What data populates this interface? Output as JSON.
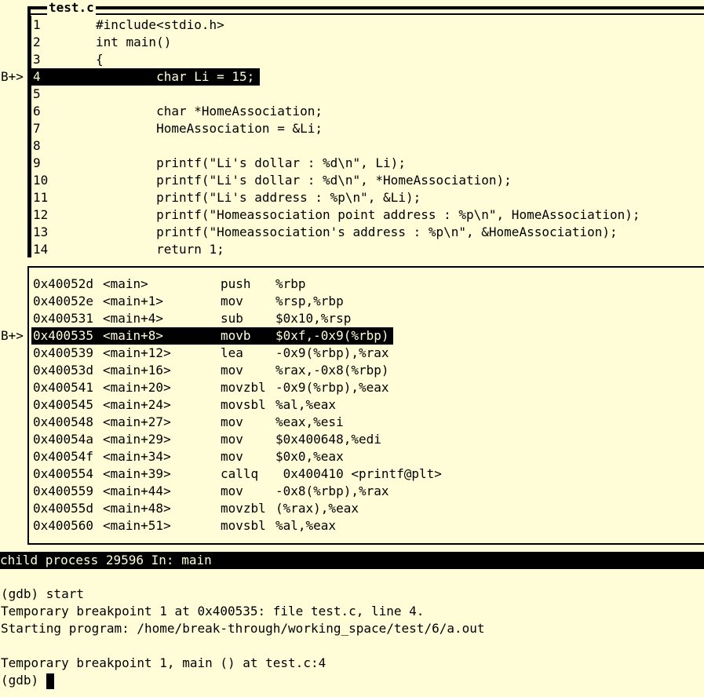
{
  "source": {
    "title": "test.c",
    "breakpoint_marker": "B+>",
    "lines": [
      {
        "num": "1",
        "code": "#include<stdio.h>"
      },
      {
        "num": "2",
        "code": "int main()"
      },
      {
        "num": "3",
        "code": "{"
      },
      {
        "num": "4",
        "code": "        char Li = 15;"
      },
      {
        "num": "5",
        "code": ""
      },
      {
        "num": "6",
        "code": "        char *HomeAssociation;"
      },
      {
        "num": "7",
        "code": "        HomeAssociation = &Li;"
      },
      {
        "num": "8",
        "code": ""
      },
      {
        "num": "9",
        "code": "        printf(\"Li's dollar : %d\\n\", Li);"
      },
      {
        "num": "10",
        "code": "        printf(\"Li's dollar : %d\\n\", *HomeAssociation);"
      },
      {
        "num": "11",
        "code": "        printf(\"Li's address : %p\\n\", &Li);"
      },
      {
        "num": "12",
        "code": "        printf(\"Homeassociation point address : %p\\n\", HomeAssociation);"
      },
      {
        "num": "13",
        "code": "        printf(\"Homeassociation's address : %p\\n\", &HomeAssociation);"
      },
      {
        "num": "14",
        "code": "        return 1;"
      }
    ]
  },
  "disasm": {
    "breakpoint_marker": "B+>",
    "rows": [
      {
        "addr": "0x40052d",
        "sym": "<main>",
        "op": "push",
        "args": "%rbp"
      },
      {
        "addr": "0x40052e",
        "sym": "<main+1>",
        "op": "mov",
        "args": "%rsp,%rbp"
      },
      {
        "addr": "0x400531",
        "sym": "<main+4>",
        "op": "sub",
        "args": "$0x10,%rsp"
      },
      {
        "addr": "0x400535",
        "sym": "<main+8>",
        "op": "movb",
        "args": "$0xf,-0x9(%rbp)"
      },
      {
        "addr": "0x400539",
        "sym": "<main+12>",
        "op": "lea",
        "args": "-0x9(%rbp),%rax"
      },
      {
        "addr": "0x40053d",
        "sym": "<main+16>",
        "op": "mov",
        "args": "%rax,-0x8(%rbp)"
      },
      {
        "addr": "0x400541",
        "sym": "<main+20>",
        "op": "movzbl",
        "args": "-0x9(%rbp),%eax"
      },
      {
        "addr": "0x400545",
        "sym": "<main+24>",
        "op": "movsbl",
        "args": "%al,%eax"
      },
      {
        "addr": "0x400548",
        "sym": "<main+27>",
        "op": "mov",
        "args": "%eax,%esi"
      },
      {
        "addr": "0x40054a",
        "sym": "<main+29>",
        "op": "mov",
        "args": "$0x400648,%edi"
      },
      {
        "addr": "0x40054f",
        "sym": "<main+34>",
        "op": "mov",
        "args": "$0x0,%eax"
      },
      {
        "addr": "0x400554",
        "sym": "<main+39>",
        "op": "callq",
        "args": " 0x400410 <printf@plt>"
      },
      {
        "addr": "0x400559",
        "sym": "<main+44>",
        "op": "mov",
        "args": "-0x8(%rbp),%rax"
      },
      {
        "addr": "0x40055d",
        "sym": "<main+48>",
        "op": "movzbl",
        "args": "(%rax),%eax"
      },
      {
        "addr": "0x400560",
        "sym": "<main+51>",
        "op": "movsbl",
        "args": "%al,%eax"
      }
    ]
  },
  "status_bar": "child process 29596 In: main",
  "console": {
    "lines": [
      "(gdb) start",
      "Temporary breakpoint 1 at 0x400535: file test.c, line 4.",
      "Starting program: /home/break-through/working_space/test/6/a.out",
      "",
      "Temporary breakpoint 1, main () at test.c:4"
    ],
    "prompt": "(gdb) "
  }
}
